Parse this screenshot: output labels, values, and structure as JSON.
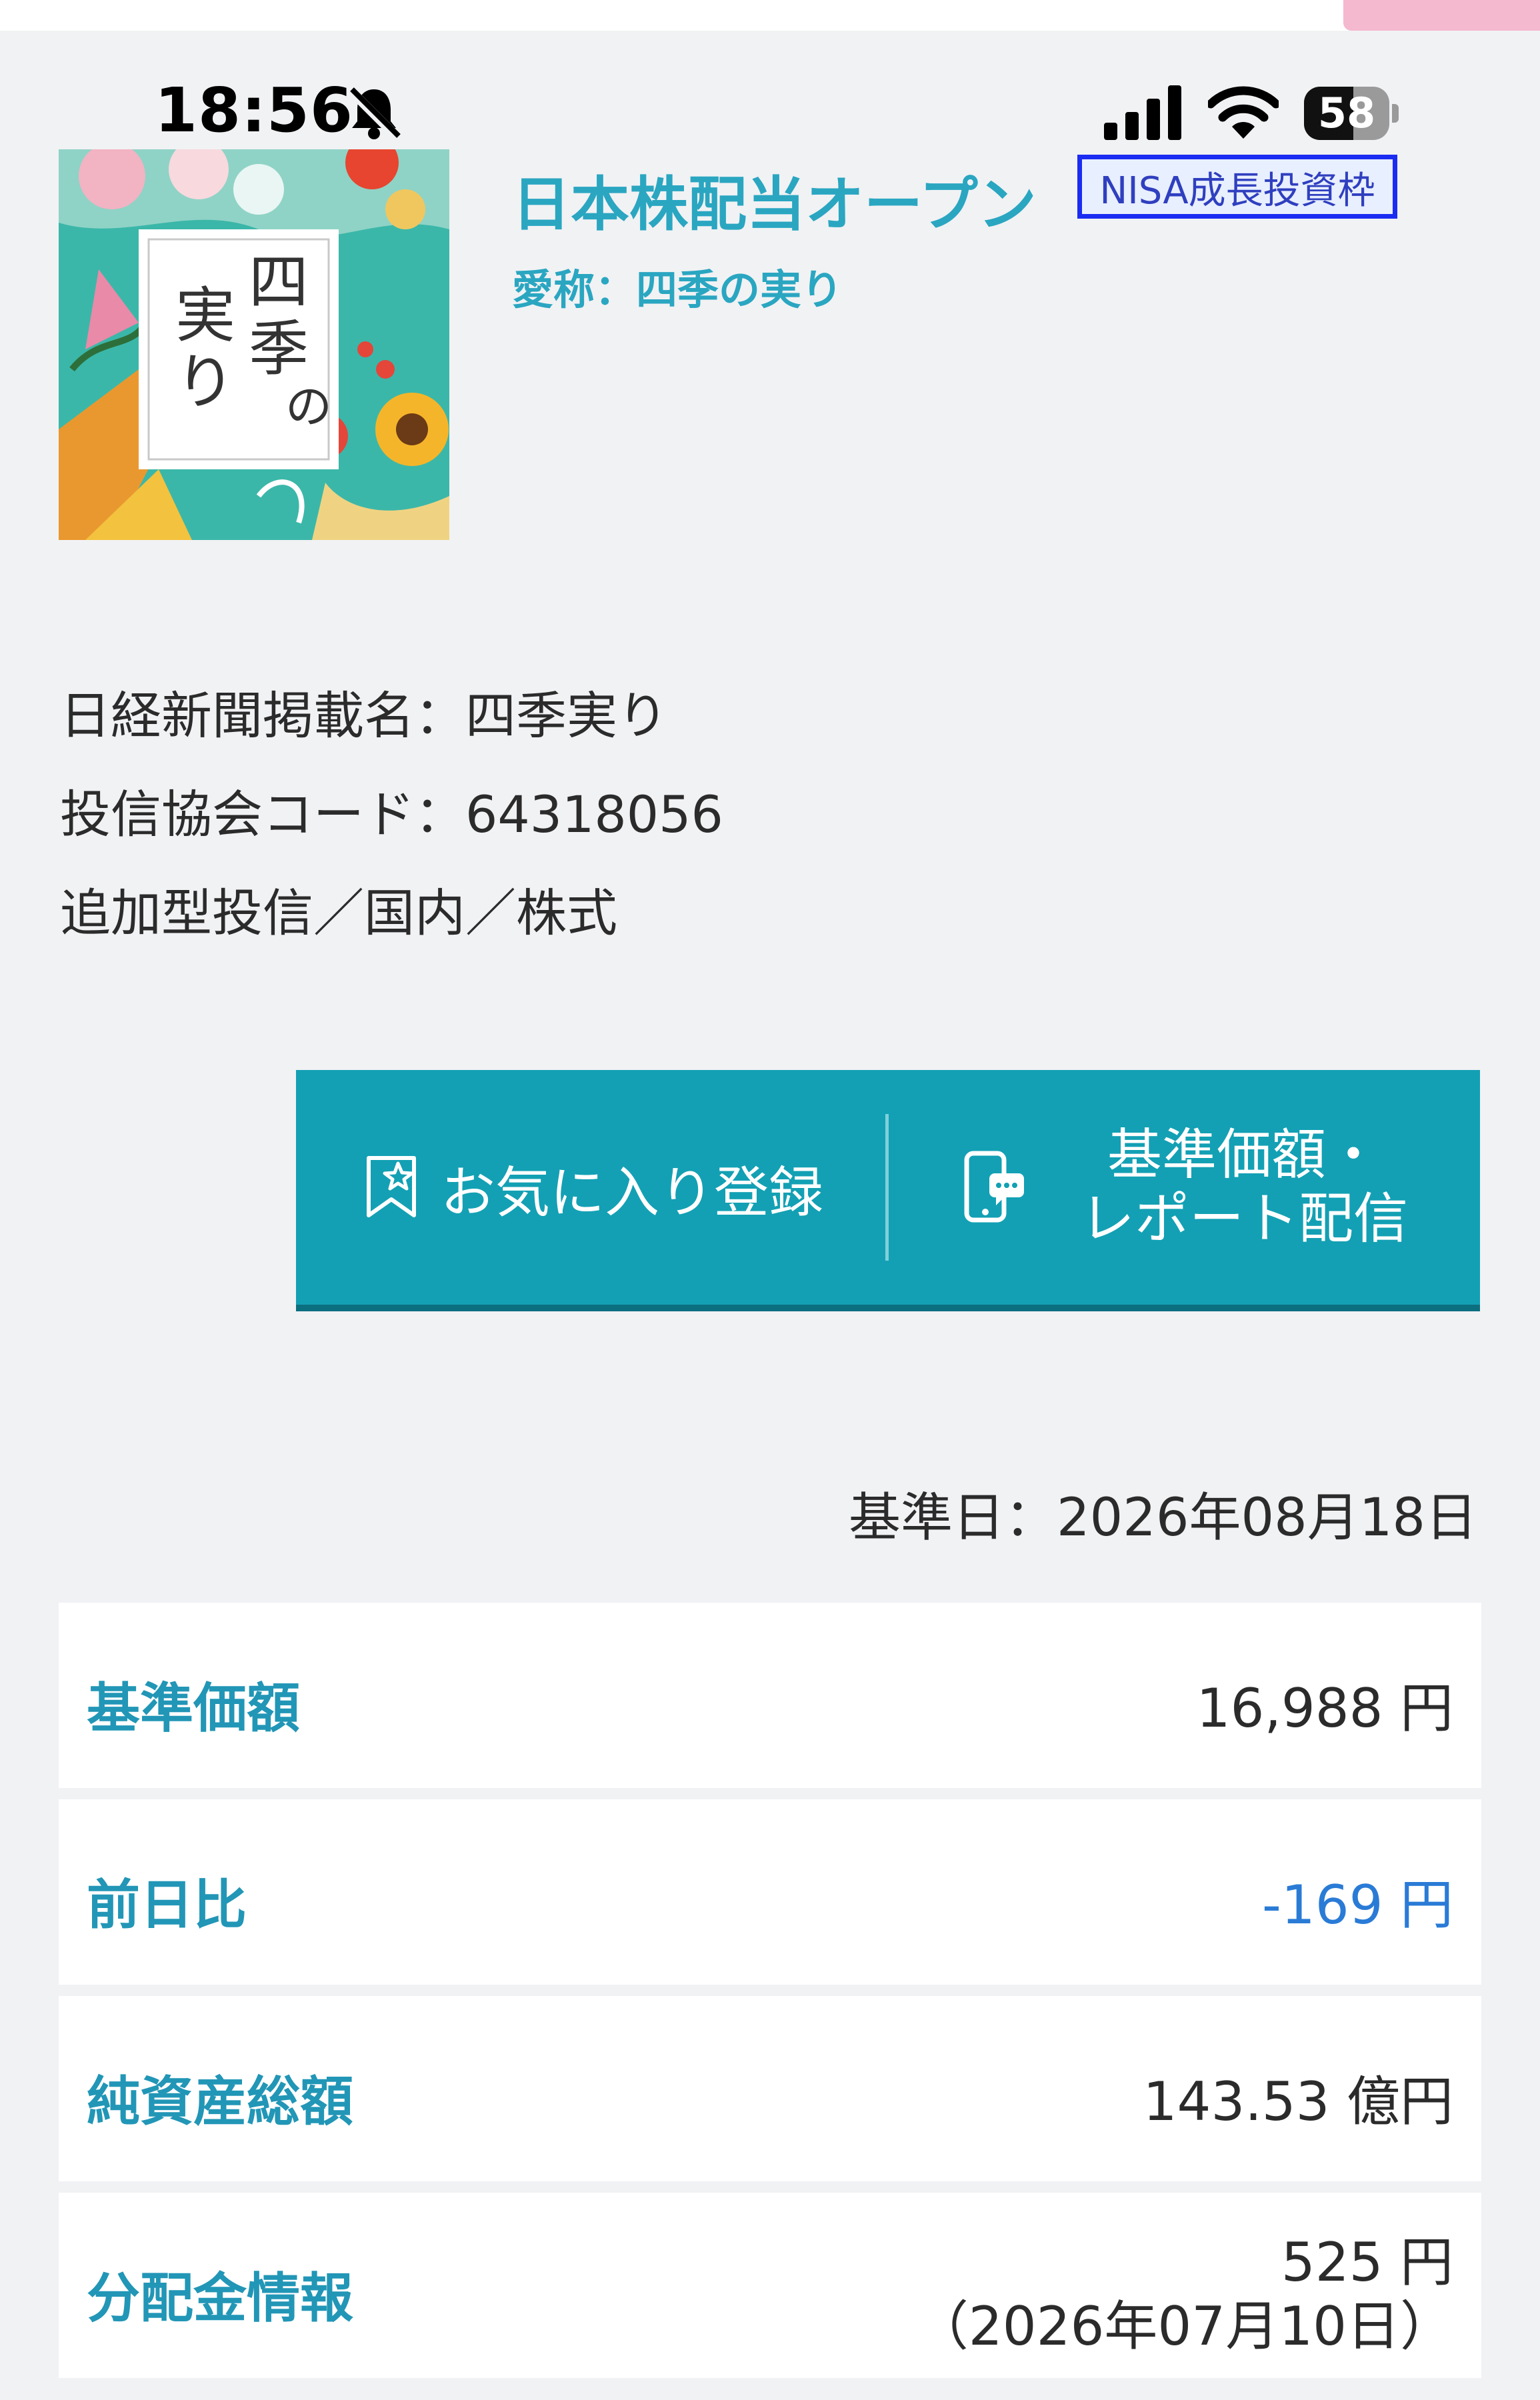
{
  "status_bar": {
    "time": "18:56",
    "battery": "58",
    "battery_level": 0.58,
    "icons": [
      "bell-slash-icon",
      "cellular-signal-icon",
      "wifi-icon",
      "battery-icon"
    ]
  },
  "fund": {
    "title": "日本株配当オープン",
    "nisa_badge": "NISA成長投資枠",
    "nickname": "愛称：四季の実り",
    "thumbnail_text": "四季の実り",
    "nikkei_name": "日経新聞掲載名：四季実り",
    "code": "投信協会コード：64318056",
    "category": "追加型投信／国内／株式"
  },
  "actions": {
    "favorite": "お気に入り登録",
    "report_line1": "基準価額・",
    "report_line2": "レポート配信"
  },
  "base_date": "基準日：2026年08月18日",
  "rows": [
    {
      "label": "基準価額",
      "value": "16,988 円"
    },
    {
      "label": "前日比",
      "value": "-169 円"
    },
    {
      "label": "純資産総額",
      "value": "143.53 億円"
    },
    {
      "label": "分配金情報",
      "value": "525 円",
      "value2": "（2026年07月10日）"
    }
  ],
  "colors": {
    "accent": "#2aa6c1",
    "action_bar": "#13a0b4",
    "negative": "#2a7bd6",
    "badge_border": "#1b2cf2"
  }
}
